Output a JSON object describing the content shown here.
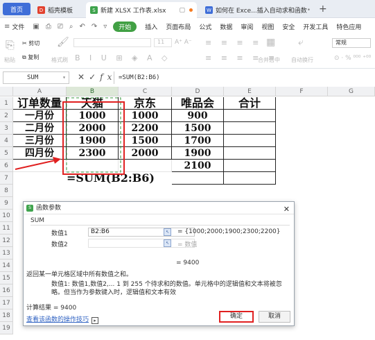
{
  "tabs": [
    {
      "label": "首页"
    },
    {
      "label": "稻壳模板"
    },
    {
      "label": "新建 XLSX 工作表.xlsx"
    },
    {
      "label": "如何在 Exce...插入自动求和函数"
    }
  ],
  "menu": {
    "file": "文件",
    "start": "开始",
    "items": [
      "插入",
      "页面布局",
      "公式",
      "数据",
      "审阅",
      "视图",
      "安全",
      "开发工具",
      "特色应用"
    ]
  },
  "ribbon": {
    "cut": "剪切",
    "copy": "复制",
    "format_painter": "格式刷",
    "paste": "粘贴",
    "font_size": "11",
    "merge": "合并居中",
    "wrap": "自动换行",
    "number_format": "常规",
    "percent": "%"
  },
  "formula_bar": {
    "name_box": "SUM",
    "formula": "=SUM(B2:B6)"
  },
  "grid": {
    "columns": [
      "A",
      "B",
      "C",
      "D",
      "E",
      "F",
      "G"
    ],
    "rows": [
      "1",
      "2",
      "3",
      "4",
      "5",
      "6",
      "7",
      "8",
      "9",
      "10",
      "11",
      "12",
      "13",
      "14",
      "15",
      "16",
      "17",
      "18",
      "19"
    ],
    "header": [
      "订单数量",
      "天猫",
      "京东",
      "唯品会",
      "合计"
    ],
    "data": [
      [
        "一月份",
        "1000",
        "1000",
        "900"
      ],
      [
        "二月份",
        "2000",
        "2200",
        "1500"
      ],
      [
        "三月份",
        "1900",
        "1500",
        "1700"
      ],
      [
        "四月份",
        "2300",
        "2000",
        "1900"
      ]
    ],
    "d6": "2100",
    "formula_cell": "=SUM(B2:B6)"
  },
  "dialog": {
    "title": "函数参数",
    "function": "SUM",
    "arg1_label": "数值1",
    "arg1_value": "B2:B6",
    "arg1_result": "= {1000;2000;1900;2300;2200}",
    "arg2_label": "数值2",
    "arg2_result": "= 数值",
    "result_eq": "= 9400",
    "description": "返回某一单元格区域中所有数值之和。",
    "arg_description": "数值1:  数值1,数值2,... 1 到 255 个待求和的数值。单元格中的逻辑值和文本将被忽略。但当作为参数键入时，逻辑值和文本有效",
    "calc_result": "计算结果 = 9400",
    "help_link": "查看该函数的操作技巧",
    "ok": "确定",
    "cancel": "取消"
  },
  "colors": {
    "accent_red": "#e02020",
    "selection_green": "#3a9a3f",
    "start_green": "#41a044",
    "home_blue": "#3f6ed8"
  }
}
